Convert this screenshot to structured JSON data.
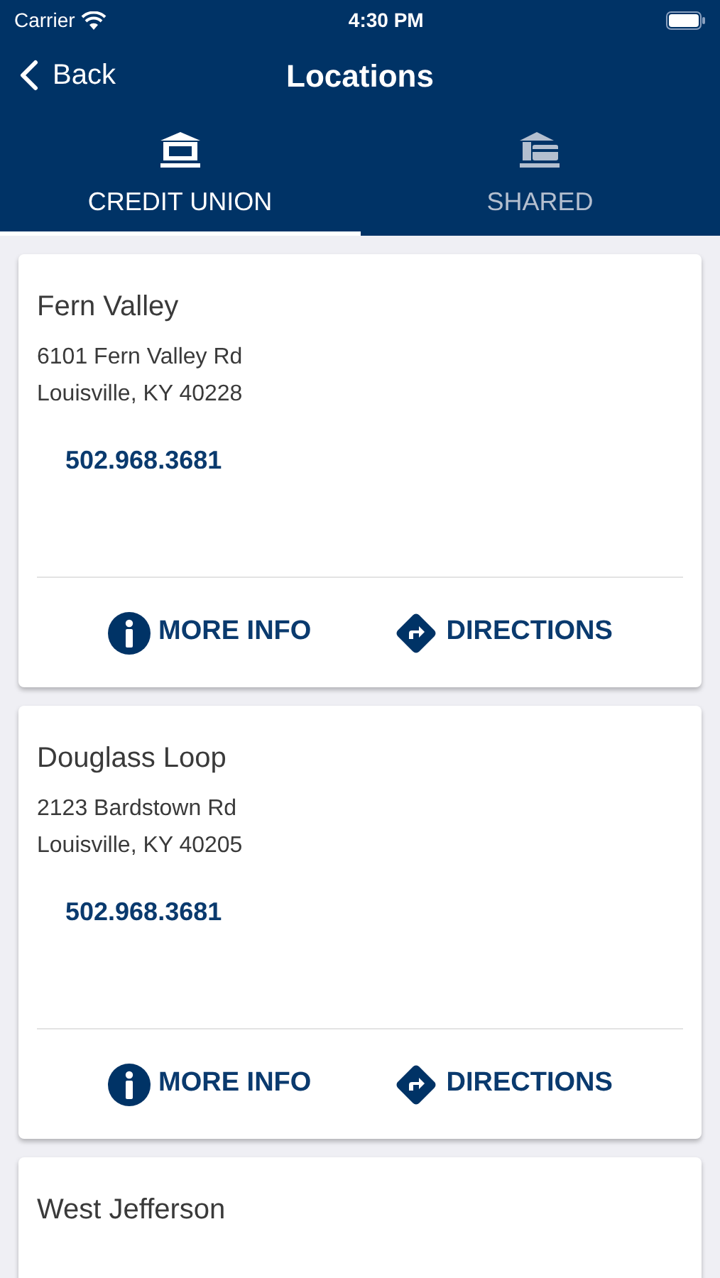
{
  "status_bar": {
    "carrier": "Carrier",
    "time": "4:30 PM"
  },
  "nav": {
    "back": "Back",
    "title": "Locations"
  },
  "tabs": [
    {
      "label": "CREDIT UNION",
      "kind": "credit-union",
      "selected": true
    },
    {
      "label": "SHARED",
      "kind": "shared",
      "selected": false
    }
  ],
  "locations": [
    {
      "name": "Fern Valley",
      "address": [
        "6101 Fern Valley Rd",
        "Louisville, KY 40228"
      ],
      "phone": "502.968.3681",
      "actions": [
        {
          "kind": "info",
          "label": "MORE INFO"
        },
        {
          "kind": "directions",
          "label": "DIRECTIONS"
        }
      ]
    },
    {
      "name": "Douglass Loop",
      "address": [
        "2123 Bardstown Rd",
        "Louisville, KY 40205"
      ],
      "phone": "502.968.3681",
      "actions": [
        {
          "kind": "info",
          "label": "MORE INFO"
        },
        {
          "kind": "directions",
          "label": "DIRECTIONS"
        }
      ]
    },
    {
      "name": "West Jefferson"
    }
  ]
}
